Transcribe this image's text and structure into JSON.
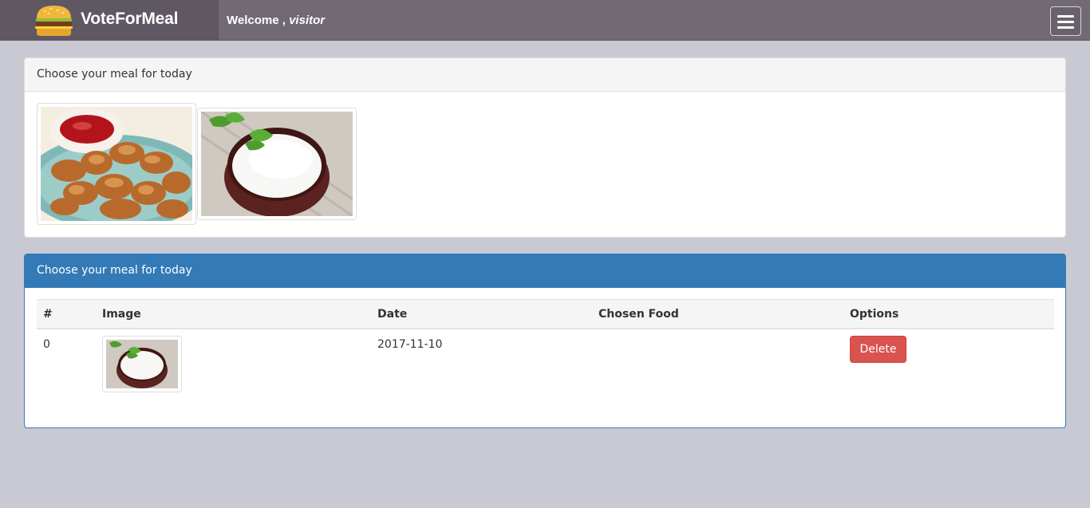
{
  "navbar": {
    "brand": "VoteForMeal",
    "logo_icon": "burger-icon",
    "welcome_prefix": "Welcome ,",
    "username": "visitor",
    "toggle_icon": "hamburger-menu-icon"
  },
  "choose_panel": {
    "title": "Choose your meal for today",
    "meals": [
      {
        "icon": "chicken-nuggets-image"
      },
      {
        "icon": "rice-bowl-image"
      }
    ]
  },
  "votes_panel": {
    "title": "Choose your meal for today",
    "columns": [
      "#",
      "Image",
      "Date",
      "Chosen Food",
      "Options"
    ],
    "rows": [
      {
        "index": "0",
        "image": "rice-bowl-image",
        "date": "2017-11-10",
        "chosen_food": "",
        "delete_label": "Delete"
      }
    ]
  },
  "colors": {
    "navbar": "#716a74",
    "brand_box": "#5f5863",
    "page_bg": "#c9c9d4",
    "primary": "#337ab7",
    "danger": "#d9534f"
  }
}
